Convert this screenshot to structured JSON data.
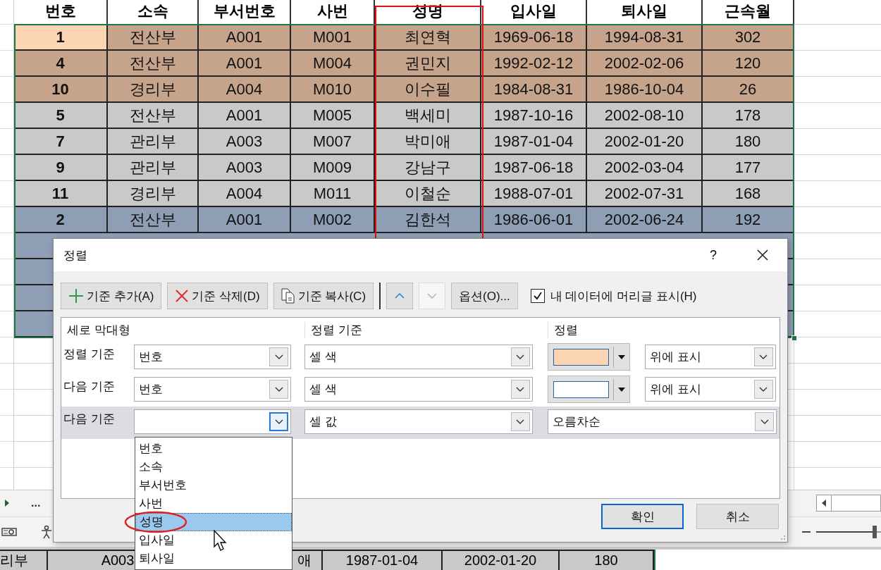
{
  "sheet": {
    "columns": [
      "번호",
      "소속",
      "부서번호",
      "사번",
      "성명",
      "입사일",
      "퇴사일",
      "근속월"
    ],
    "rows": [
      {
        "color": "#c5a48b",
        "lead": {
          "color": "#fcd5b4"
        },
        "cells": [
          "1",
          "전산부",
          "A001",
          "M001",
          "최연혁",
          "1969-06-18",
          "1994-08-31",
          "302"
        ]
      },
      {
        "color": "#c5a48b",
        "cells": [
          "4",
          "전산부",
          "A001",
          "M004",
          "권민지",
          "1992-02-12",
          "2002-02-06",
          "120"
        ]
      },
      {
        "color": "#c5a48b",
        "cells": [
          "10",
          "경리부",
          "A004",
          "M010",
          "이수필",
          "1984-08-31",
          "1986-10-04",
          "26"
        ]
      },
      {
        "color": "#c9c9c9",
        "cells": [
          "5",
          "전산부",
          "A001",
          "M005",
          "백세미",
          "1987-10-16",
          "2002-08-10",
          "178"
        ]
      },
      {
        "color": "#c9c9c9",
        "cells": [
          "7",
          "관리부",
          "A003",
          "M007",
          "박미애",
          "1987-01-04",
          "2002-01-20",
          "180"
        ]
      },
      {
        "color": "#c9c9c9",
        "cells": [
          "9",
          "관리부",
          "A003",
          "M009",
          "강남구",
          "1987-06-18",
          "2002-03-04",
          "177"
        ]
      },
      {
        "color": "#c9c9c9",
        "cells": [
          "11",
          "경리부",
          "A004",
          "M011",
          "이철순",
          "1988-07-01",
          "2002-07-31",
          "168"
        ]
      },
      {
        "color": "#8e9eb4",
        "cells": [
          "2",
          "전산부",
          "A001",
          "M002",
          "김한석",
          "1986-06-01",
          "2002-06-24",
          "192"
        ]
      }
    ],
    "hidden_rows": [
      {
        "color": "#8e9eb4"
      },
      {
        "color": "#8e9eb4"
      },
      {
        "color": "#8e9eb4"
      },
      {
        "color": "#8e9eb4"
      }
    ],
    "lower_row": {
      "color": "#c9c9c9",
      "cells": [
        "리부",
        "A003",
        "애",
        "1987-01-04",
        "2002-01-20",
        "180"
      ]
    }
  },
  "sheet_tabs": {
    "more": "..."
  },
  "zoom_slider": {
    "level": 0.9
  },
  "dialog": {
    "title": "정렬",
    "help": "?",
    "toolbar": [
      {
        "kind": "add",
        "label": "기준 추가(A)"
      },
      {
        "kind": "delete",
        "label": "기준 삭제(D)"
      },
      {
        "kind": "copy",
        "label": "기준 복사(C)"
      }
    ],
    "move_buttons": [
      {
        "kind": "up",
        "disabled": false
      },
      {
        "kind": "down",
        "disabled": true
      }
    ],
    "options": "옵션(O)...",
    "header_checkbox": {
      "label": "내 데이터에 머리글 표시(H)",
      "checked": true
    },
    "headers": [
      "세로 막대형",
      "정렬 기준",
      "정렬"
    ],
    "levels": [
      {
        "label": "정렬 기준",
        "column": "번호",
        "sort_on": "셀 색",
        "order": {
          "kind": "color",
          "color": "#fcd5b4",
          "position": "위에 표시"
        },
        "selected": false,
        "open": false
      },
      {
        "label": "다음 기준",
        "column": "번호",
        "sort_on": "셀 색",
        "order": {
          "kind": "color",
          "color": "#ffffff",
          "position": "위에 표시"
        },
        "selected": false,
        "open": false
      },
      {
        "label": "다음 기준",
        "sort_on": "셀 값",
        "order": {
          "kind": "value",
          "value": "오름차순"
        },
        "selected": true,
        "open": true
      }
    ],
    "dropdown": [
      {
        "label": "번호",
        "selected": false
      },
      {
        "label": "소속",
        "selected": false
      },
      {
        "label": "부서번호",
        "selected": false
      },
      {
        "label": "사번",
        "selected": false
      },
      {
        "label": "성명",
        "selected": true
      },
      {
        "label": "입사일",
        "selected": false
      },
      {
        "label": "퇴사일",
        "selected": false
      }
    ],
    "buttons": [
      {
        "label": "확인",
        "default": true
      },
      {
        "label": "취소",
        "default": false
      }
    ]
  }
}
